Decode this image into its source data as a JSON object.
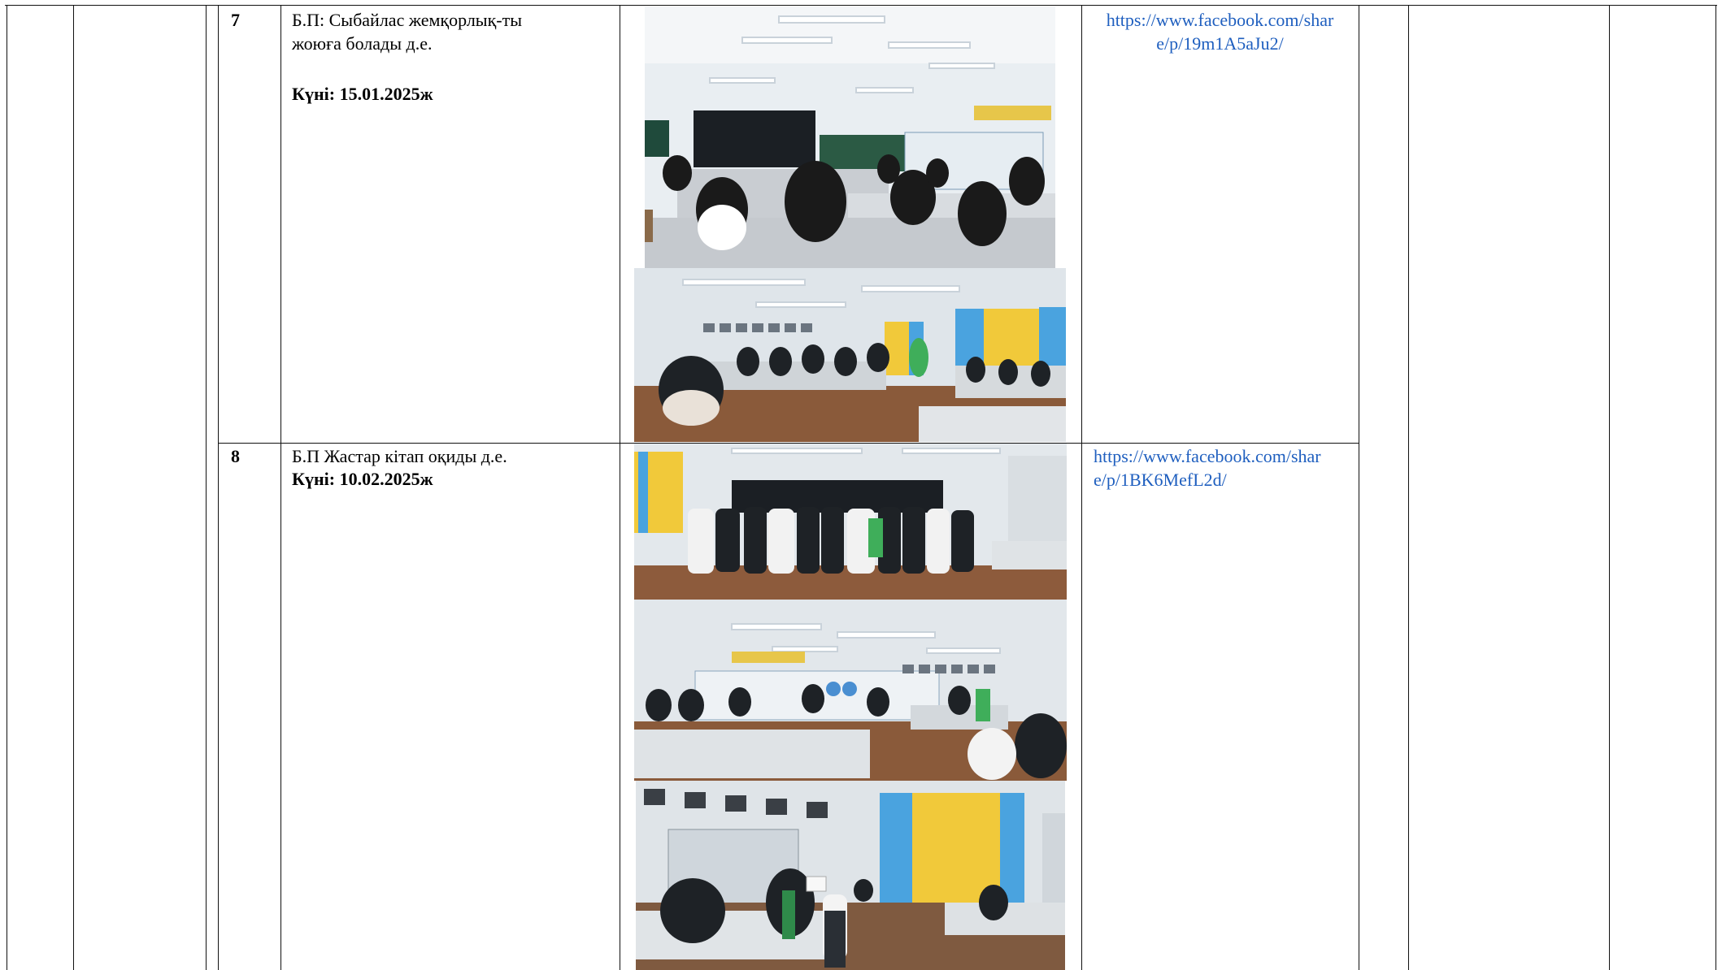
{
  "rows": [
    {
      "number": "7",
      "title": "Б.П:  Сыбайлас жемқорлық-ты жоюға болады д.е.",
      "date_label": "Күні: 15.01.2025ж",
      "link_line1": "https://www.facebook.com/shar",
      "link_line2": "e/p/19m1A5aJu2/"
    },
    {
      "number": "8",
      "title": "Б.П Жастар кітап оқиды д.е.",
      "date_label": "Күні: 10.02.2025ж",
      "link_line1": "https://www.facebook.com/shar",
      "link_line2": "e/p/1BK6MefL2d/"
    }
  ]
}
